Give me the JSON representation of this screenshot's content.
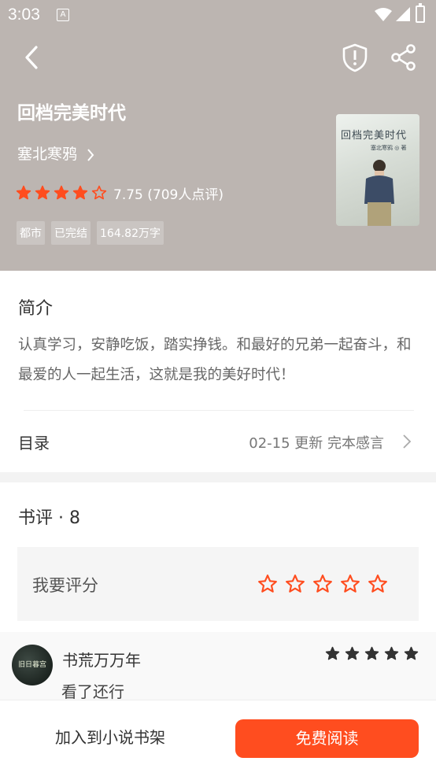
{
  "status_bar": {
    "time": "3:03",
    "notification_glyph": "A"
  },
  "colors": {
    "accent": "#ff4d1f",
    "header_bg": "#bcb5b1",
    "star": "#ff4d1f"
  },
  "book": {
    "title": "回档完美时代",
    "author": "塞北寒鸦",
    "rating_value": 7.75,
    "rating_text": "7.75 (709人点评)",
    "stars_filled": 4,
    "stars_total": 5,
    "tags": [
      "都市",
      "已完结",
      "164.82万字"
    ],
    "cover": {
      "title_text": "回档完美时代",
      "author_text": "塞北寒鸦 ◎ 著"
    }
  },
  "intro": {
    "heading": "简介",
    "body": "认真学习，安静吃饭，踏实挣钱。和最好的兄弟一起奋斗，和最爱的人一起生活，这就是我的美好时代！"
  },
  "toc": {
    "label": "目录",
    "info": "02-15 更新 完本感言"
  },
  "reviews": {
    "heading": "书评 · 8",
    "rate_prompt": "我要评分",
    "items": [
      {
        "user": "书荒万万年",
        "text": "看了还行",
        "stars": 5,
        "avatar_text": "旧日暮宫"
      }
    ]
  },
  "actions": {
    "add_to_shelf": "加入到小说书架",
    "read_free": "免费阅读"
  },
  "icons": [
    "back-icon",
    "shield-icon",
    "share-icon",
    "chevron-right-icon",
    "star-icon",
    "wifi-icon",
    "signal-icon",
    "battery-icon"
  ]
}
